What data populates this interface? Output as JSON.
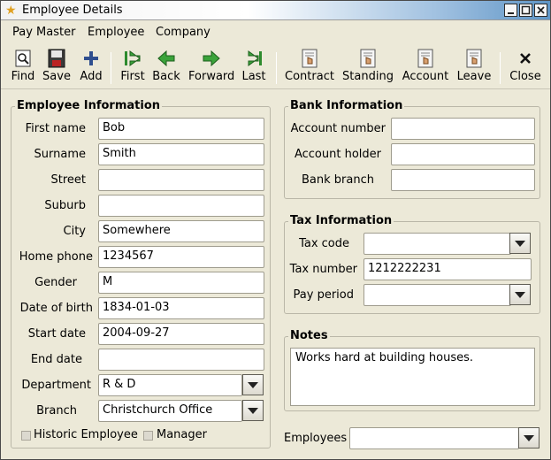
{
  "window": {
    "title": "Employee Details"
  },
  "menu": [
    "Pay Master",
    "Employee",
    "Company"
  ],
  "toolbar": {
    "find": "Find",
    "save": "Save",
    "add": "Add",
    "first": "First",
    "back": "Back",
    "forward": "Forward",
    "last": "Last",
    "contract": "Contract",
    "standing": "Standing",
    "account": "Account",
    "leave": "Leave",
    "close": "Close"
  },
  "employee": {
    "title": "Employee Information",
    "first_name": {
      "label": "First name",
      "value": "Bob"
    },
    "surname": {
      "label": "Surname",
      "value": "Smith"
    },
    "street": {
      "label": "Street",
      "value": ""
    },
    "suburb": {
      "label": "Suburb",
      "value": ""
    },
    "city": {
      "label": "City",
      "value": "Somewhere"
    },
    "home_phone": {
      "label": "Home phone",
      "value": "1234567"
    },
    "gender": {
      "label": "Gender",
      "value": "M"
    },
    "dob": {
      "label": "Date of birth",
      "value": "1834-01-03"
    },
    "start_date": {
      "label": "Start date",
      "value": "2004-09-27"
    },
    "end_date": {
      "label": "End date",
      "value": ""
    },
    "department": {
      "label": "Department",
      "value": "R & D"
    },
    "branch": {
      "label": "Branch",
      "value": "Christchurch Office"
    },
    "historic": {
      "label": "Historic Employee",
      "checked": false
    },
    "manager": {
      "label": "Manager",
      "checked": false
    }
  },
  "bank": {
    "title": "Bank Information",
    "account_number": {
      "label": "Account number",
      "value": ""
    },
    "account_holder": {
      "label": "Account holder",
      "value": ""
    },
    "bank_branch": {
      "label": "Bank branch",
      "value": ""
    }
  },
  "tax": {
    "title": "Tax Information",
    "tax_code": {
      "label": "Tax code",
      "value": ""
    },
    "tax_number": {
      "label": "Tax number",
      "value": "1212222231"
    },
    "pay_period": {
      "label": "Pay period",
      "value": ""
    }
  },
  "notes": {
    "title": "Notes",
    "text": "Works hard at building houses."
  },
  "employees": {
    "label": "Employees",
    "value": ""
  },
  "colors": {
    "window_bg": "#ece9d8",
    "accent_green": "#2e8b2e",
    "border": "#9f9c8e"
  }
}
